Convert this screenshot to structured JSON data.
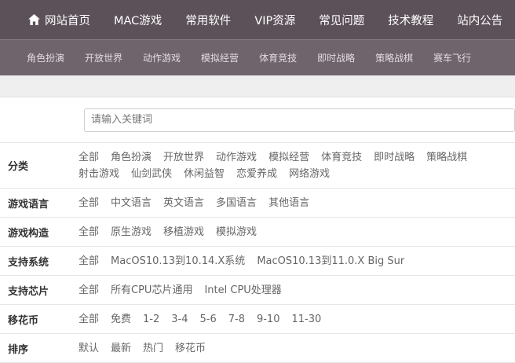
{
  "topnav": {
    "items": [
      "网站首页",
      "MAC游戏",
      "常用软件",
      "VIP资源",
      "常见问题",
      "技术教程",
      "站内公告"
    ]
  },
  "subnav": {
    "items": [
      "角色扮演",
      "开放世界",
      "动作游戏",
      "模拟经营",
      "体育竞技",
      "即时战略",
      "策略战棋",
      "赛车飞行"
    ]
  },
  "search": {
    "placeholder": "请输入关键词"
  },
  "filters": [
    {
      "label": "分类",
      "options": [
        "全部",
        "角色扮演",
        "开放世界",
        "动作游戏",
        "模拟经营",
        "体育竞技",
        "即时战略",
        "策略战棋",
        "射击游戏",
        "仙剑武侠",
        "休闲益智",
        "恋爱养成",
        "网络游戏"
      ]
    },
    {
      "label": "游戏语言",
      "options": [
        "全部",
        "中文语言",
        "英文语言",
        "多国语言",
        "其他语言"
      ]
    },
    {
      "label": "游戏构造",
      "options": [
        "全部",
        "原生游戏",
        "移植游戏",
        "模拟游戏"
      ]
    },
    {
      "label": "支持系统",
      "options": [
        "全部",
        "MacOS10.13到10.14.X系统",
        "MacOS10.13到11.0.X Big Sur"
      ]
    },
    {
      "label": "支持芯片",
      "options": [
        "全部",
        "所有CPU芯片通用",
        "Intel CPU处理器"
      ]
    },
    {
      "label": "移花币",
      "options": [
        "全部",
        "免费",
        "1-2",
        "3-4",
        "5-6",
        "7-8",
        "9-10",
        "11-30"
      ]
    },
    {
      "label": "排序",
      "options": [
        "默认",
        "最新",
        "热门",
        "移花币"
      ]
    }
  ],
  "colors": {
    "topnav_bg": "#5c5059",
    "subnav_bg": "#6f646c"
  }
}
